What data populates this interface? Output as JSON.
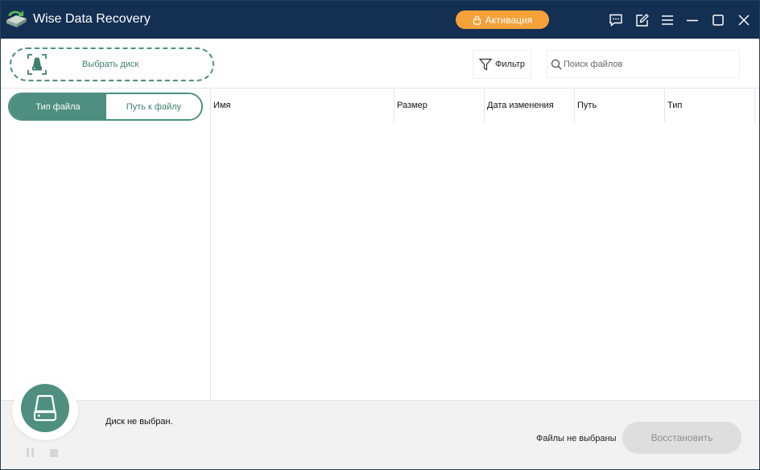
{
  "titlebar": {
    "title": "Wise Data Recovery",
    "activation_label": "Активация",
    "icons": [
      "feedback-icon",
      "edit-icon",
      "menu-icon",
      "minimize-icon",
      "maximize-icon",
      "close-icon"
    ]
  },
  "toolbar": {
    "select_disk_label": "Выбрать диск",
    "filter_label": "Фильтр",
    "search_placeholder": "Поиск файлов"
  },
  "left_panel": {
    "tabs": [
      {
        "label": "Тип файла",
        "active": true
      },
      {
        "label": "Путь к файлу",
        "active": false
      }
    ]
  },
  "table": {
    "columns": [
      "Имя",
      "Размер",
      "Дата изменения",
      "Путь",
      "Тип"
    ]
  },
  "bottom": {
    "disk_status": "Диск не выбран.",
    "files_status": "Файлы не выбраны",
    "restore_label": "Восстановить"
  },
  "colors": {
    "titlebar": "#132f52",
    "accent_green": "#4f8f7f",
    "activation": "#f4a13a"
  }
}
